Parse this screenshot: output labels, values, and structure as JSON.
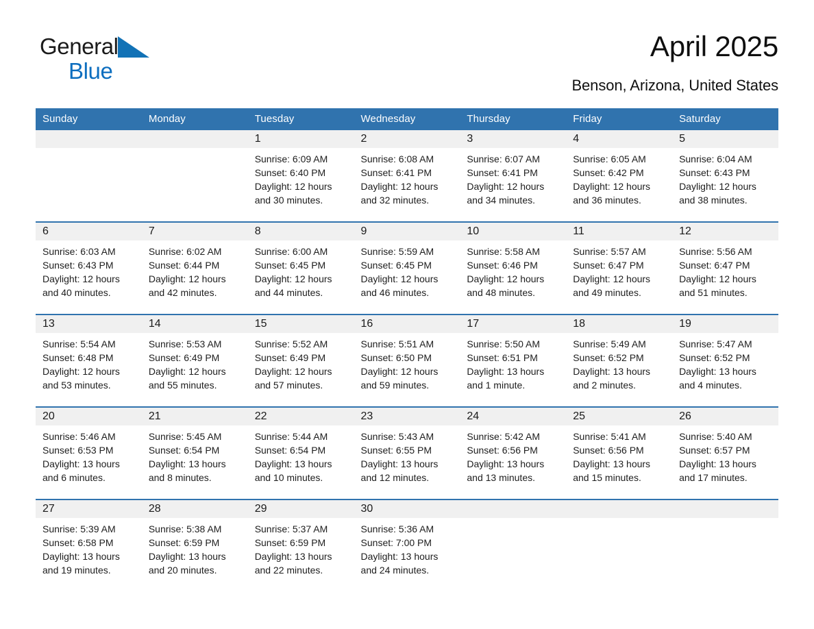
{
  "brand": {
    "name_part1": "General",
    "name_part2": "Blue",
    "triangle_color": "#1272b6",
    "blue_color": "#0d6ebf"
  },
  "header": {
    "title": "April 2025",
    "subtitle": "Benson, Arizona, United States"
  },
  "theme": {
    "header_blue": "#3073ae",
    "row_rule_blue": "#3073ae",
    "daynum_band": "#f0f0f0",
    "text": "#1a1a1a"
  },
  "weekday_headers": [
    "Sunday",
    "Monday",
    "Tuesday",
    "Wednesday",
    "Thursday",
    "Friday",
    "Saturday"
  ],
  "weeks": [
    [
      {
        "day": "",
        "empty": true
      },
      {
        "day": "",
        "empty": true
      },
      {
        "day": "1",
        "sunrise": "Sunrise: 6:09 AM",
        "sunset": "Sunset: 6:40 PM",
        "daylight_1": "Daylight: 12 hours",
        "daylight_2": "and 30 minutes."
      },
      {
        "day": "2",
        "sunrise": "Sunrise: 6:08 AM",
        "sunset": "Sunset: 6:41 PM",
        "daylight_1": "Daylight: 12 hours",
        "daylight_2": "and 32 minutes."
      },
      {
        "day": "3",
        "sunrise": "Sunrise: 6:07 AM",
        "sunset": "Sunset: 6:41 PM",
        "daylight_1": "Daylight: 12 hours",
        "daylight_2": "and 34 minutes."
      },
      {
        "day": "4",
        "sunrise": "Sunrise: 6:05 AM",
        "sunset": "Sunset: 6:42 PM",
        "daylight_1": "Daylight: 12 hours",
        "daylight_2": "and 36 minutes."
      },
      {
        "day": "5",
        "sunrise": "Sunrise: 6:04 AM",
        "sunset": "Sunset: 6:43 PM",
        "daylight_1": "Daylight: 12 hours",
        "daylight_2": "and 38 minutes."
      }
    ],
    [
      {
        "day": "6",
        "sunrise": "Sunrise: 6:03 AM",
        "sunset": "Sunset: 6:43 PM",
        "daylight_1": "Daylight: 12 hours",
        "daylight_2": "and 40 minutes."
      },
      {
        "day": "7",
        "sunrise": "Sunrise: 6:02 AM",
        "sunset": "Sunset: 6:44 PM",
        "daylight_1": "Daylight: 12 hours",
        "daylight_2": "and 42 minutes."
      },
      {
        "day": "8",
        "sunrise": "Sunrise: 6:00 AM",
        "sunset": "Sunset: 6:45 PM",
        "daylight_1": "Daylight: 12 hours",
        "daylight_2": "and 44 minutes."
      },
      {
        "day": "9",
        "sunrise": "Sunrise: 5:59 AM",
        "sunset": "Sunset: 6:45 PM",
        "daylight_1": "Daylight: 12 hours",
        "daylight_2": "and 46 minutes."
      },
      {
        "day": "10",
        "sunrise": "Sunrise: 5:58 AM",
        "sunset": "Sunset: 6:46 PM",
        "daylight_1": "Daylight: 12 hours",
        "daylight_2": "and 48 minutes."
      },
      {
        "day": "11",
        "sunrise": "Sunrise: 5:57 AM",
        "sunset": "Sunset: 6:47 PM",
        "daylight_1": "Daylight: 12 hours",
        "daylight_2": "and 49 minutes."
      },
      {
        "day": "12",
        "sunrise": "Sunrise: 5:56 AM",
        "sunset": "Sunset: 6:47 PM",
        "daylight_1": "Daylight: 12 hours",
        "daylight_2": "and 51 minutes."
      }
    ],
    [
      {
        "day": "13",
        "sunrise": "Sunrise: 5:54 AM",
        "sunset": "Sunset: 6:48 PM",
        "daylight_1": "Daylight: 12 hours",
        "daylight_2": "and 53 minutes."
      },
      {
        "day": "14",
        "sunrise": "Sunrise: 5:53 AM",
        "sunset": "Sunset: 6:49 PM",
        "daylight_1": "Daylight: 12 hours",
        "daylight_2": "and 55 minutes."
      },
      {
        "day": "15",
        "sunrise": "Sunrise: 5:52 AM",
        "sunset": "Sunset: 6:49 PM",
        "daylight_1": "Daylight: 12 hours",
        "daylight_2": "and 57 minutes."
      },
      {
        "day": "16",
        "sunrise": "Sunrise: 5:51 AM",
        "sunset": "Sunset: 6:50 PM",
        "daylight_1": "Daylight: 12 hours",
        "daylight_2": "and 59 minutes."
      },
      {
        "day": "17",
        "sunrise": "Sunrise: 5:50 AM",
        "sunset": "Sunset: 6:51 PM",
        "daylight_1": "Daylight: 13 hours",
        "daylight_2": "and 1 minute."
      },
      {
        "day": "18",
        "sunrise": "Sunrise: 5:49 AM",
        "sunset": "Sunset: 6:52 PM",
        "daylight_1": "Daylight: 13 hours",
        "daylight_2": "and 2 minutes."
      },
      {
        "day": "19",
        "sunrise": "Sunrise: 5:47 AM",
        "sunset": "Sunset: 6:52 PM",
        "daylight_1": "Daylight: 13 hours",
        "daylight_2": "and 4 minutes."
      }
    ],
    [
      {
        "day": "20",
        "sunrise": "Sunrise: 5:46 AM",
        "sunset": "Sunset: 6:53 PM",
        "daylight_1": "Daylight: 13 hours",
        "daylight_2": "and 6 minutes."
      },
      {
        "day": "21",
        "sunrise": "Sunrise: 5:45 AM",
        "sunset": "Sunset: 6:54 PM",
        "daylight_1": "Daylight: 13 hours",
        "daylight_2": "and 8 minutes."
      },
      {
        "day": "22",
        "sunrise": "Sunrise: 5:44 AM",
        "sunset": "Sunset: 6:54 PM",
        "daylight_1": "Daylight: 13 hours",
        "daylight_2": "and 10 minutes."
      },
      {
        "day": "23",
        "sunrise": "Sunrise: 5:43 AM",
        "sunset": "Sunset: 6:55 PM",
        "daylight_1": "Daylight: 13 hours",
        "daylight_2": "and 12 minutes."
      },
      {
        "day": "24",
        "sunrise": "Sunrise: 5:42 AM",
        "sunset": "Sunset: 6:56 PM",
        "daylight_1": "Daylight: 13 hours",
        "daylight_2": "and 13 minutes."
      },
      {
        "day": "25",
        "sunrise": "Sunrise: 5:41 AM",
        "sunset": "Sunset: 6:56 PM",
        "daylight_1": "Daylight: 13 hours",
        "daylight_2": "and 15 minutes."
      },
      {
        "day": "26",
        "sunrise": "Sunrise: 5:40 AM",
        "sunset": "Sunset: 6:57 PM",
        "daylight_1": "Daylight: 13 hours",
        "daylight_2": "and 17 minutes."
      }
    ],
    [
      {
        "day": "27",
        "sunrise": "Sunrise: 5:39 AM",
        "sunset": "Sunset: 6:58 PM",
        "daylight_1": "Daylight: 13 hours",
        "daylight_2": "and 19 minutes."
      },
      {
        "day": "28",
        "sunrise": "Sunrise: 5:38 AM",
        "sunset": "Sunset: 6:59 PM",
        "daylight_1": "Daylight: 13 hours",
        "daylight_2": "and 20 minutes."
      },
      {
        "day": "29",
        "sunrise": "Sunrise: 5:37 AM",
        "sunset": "Sunset: 6:59 PM",
        "daylight_1": "Daylight: 13 hours",
        "daylight_2": "and 22 minutes."
      },
      {
        "day": "30",
        "sunrise": "Sunrise: 5:36 AM",
        "sunset": "Sunset: 7:00 PM",
        "daylight_1": "Daylight: 13 hours",
        "daylight_2": "and 24 minutes."
      },
      {
        "day": "",
        "empty": true
      },
      {
        "day": "",
        "empty": true
      },
      {
        "day": "",
        "empty": true
      }
    ]
  ]
}
